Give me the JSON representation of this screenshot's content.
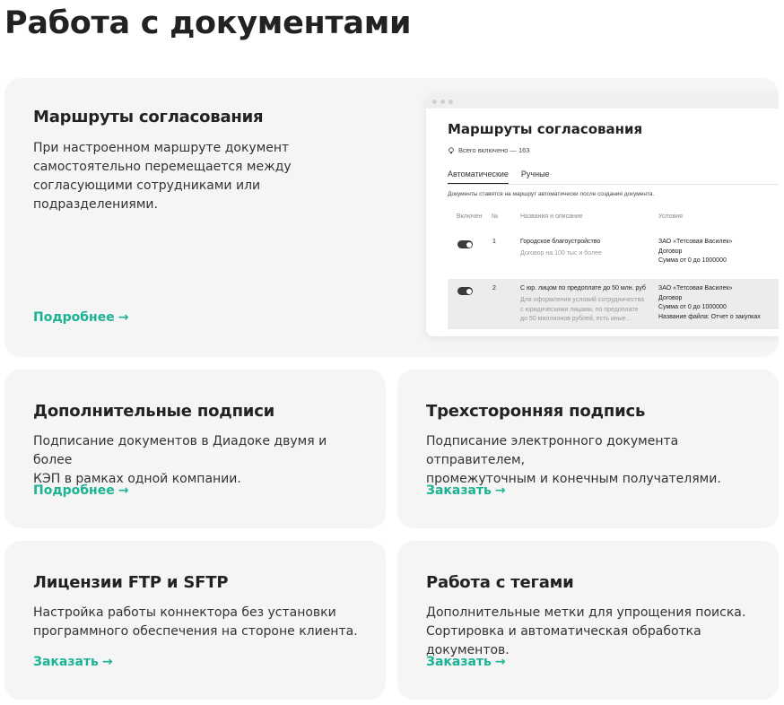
{
  "page": {
    "title": "Работа с документами"
  },
  "colors": {
    "accent": "#1ab394",
    "card_bg": "#f5f5f5"
  },
  "routes_card": {
    "title": "Маршруты согласования",
    "description": "При настроенном маршруте документ самостоятельно перемещается между согласующими сотрудниками или подразделениями.",
    "link": "Подробнее",
    "mock": {
      "title": "Маршруты согласования",
      "count": "Всего включено — 163",
      "count_icon": "lightbulb-icon",
      "tabs": [
        "Автоматические",
        "Ручные"
      ],
      "active_tab": "Автоматические",
      "note": "Документы ставятся на маршрут автоматически после создания документа.",
      "columns": [
        "Включен",
        "№",
        "Названия и описание",
        "Условия"
      ],
      "rows": [
        {
          "enabled": true,
          "num": "1",
          "name": "Городское благоустройство",
          "desc": "Договор на 100 тыс и более",
          "conditions": [
            "ЗАО «Тетсовая Василек»",
            "Договор",
            "Сумма от 0 до 1000000"
          ]
        },
        {
          "enabled": true,
          "num": "2",
          "name": "С юр. лицом по предоплате до 50 млн. руб",
          "desc": [
            "Для оформления условий сотрудничества",
            "с юридическими лицами, по предоплате",
            "до 50 миллионов рублей, есть иные..."
          ],
          "conditions": [
            "ЗАО «Тетсовая Василек»",
            "Договор",
            "Сумма от 0 до 1000000",
            "Название файла: Отчет о закупках"
          ]
        }
      ]
    }
  },
  "cards": [
    {
      "title": "Дополнительные подписи",
      "description": [
        "Подписание документов в Диадоке двумя и более",
        "КЭП в рамках одной компании."
      ],
      "link": "Подробнее"
    },
    {
      "title": "Трехсторонняя подпись",
      "description": [
        "Подписание электронного документа отправителем,",
        "промежуточным и конечным получателями."
      ],
      "link": "Заказать"
    },
    {
      "title": "Лицензии FTP и SFTP",
      "description": [
        "Настройка работы коннектора без установки",
        "программного обеспечения на стороне клиента."
      ],
      "link": "Заказать"
    },
    {
      "title": "Работа с тегами",
      "description": [
        "Дополнительные метки для упрощения поиска.",
        "Сортировка и автоматическая обработка документов."
      ],
      "link": "Заказать"
    }
  ],
  "link_arrow": "→"
}
